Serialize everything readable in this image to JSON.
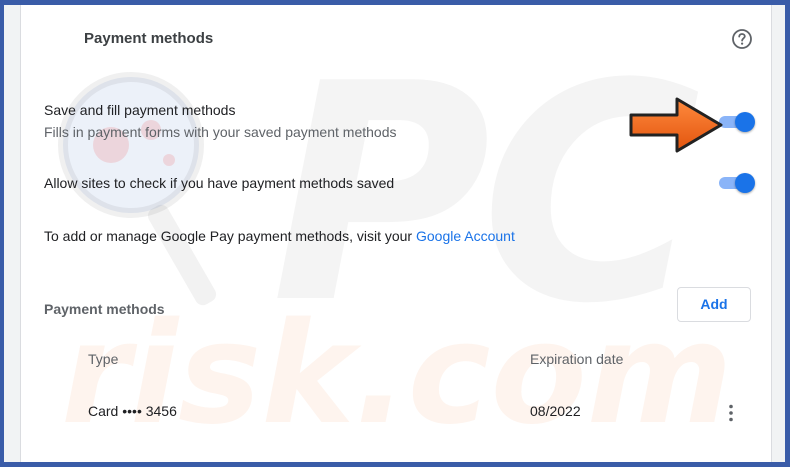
{
  "section_title": "Payment methods",
  "save_fill": {
    "title": "Save and fill payment methods",
    "subtitle": "Fills in payment forms with your saved payment methods",
    "enabled": true
  },
  "allow_check": {
    "title": "Allow sites to check if you have payment methods saved",
    "enabled": true
  },
  "google_pay": {
    "text": "To add or manage Google Pay payment methods, visit your ",
    "link": "Google Account"
  },
  "payment_list": {
    "label": "Payment methods",
    "add_label": "Add",
    "columns": {
      "type": "Type",
      "expiration": "Expiration date"
    },
    "rows": [
      {
        "type": "Card •••• 3456",
        "expiration": "08/2022"
      }
    ]
  },
  "watermark": {
    "brand": "PC",
    "site": "risk.com"
  },
  "colors": {
    "accent": "#1a73e8",
    "toggle_track": "#8ab4f8",
    "arrow": "#f26522",
    "frame": "#3a5ca8"
  },
  "icons": {
    "help": "help-circle-icon",
    "more": "more-vert-icon",
    "arrow": "arrow-right-icon"
  }
}
